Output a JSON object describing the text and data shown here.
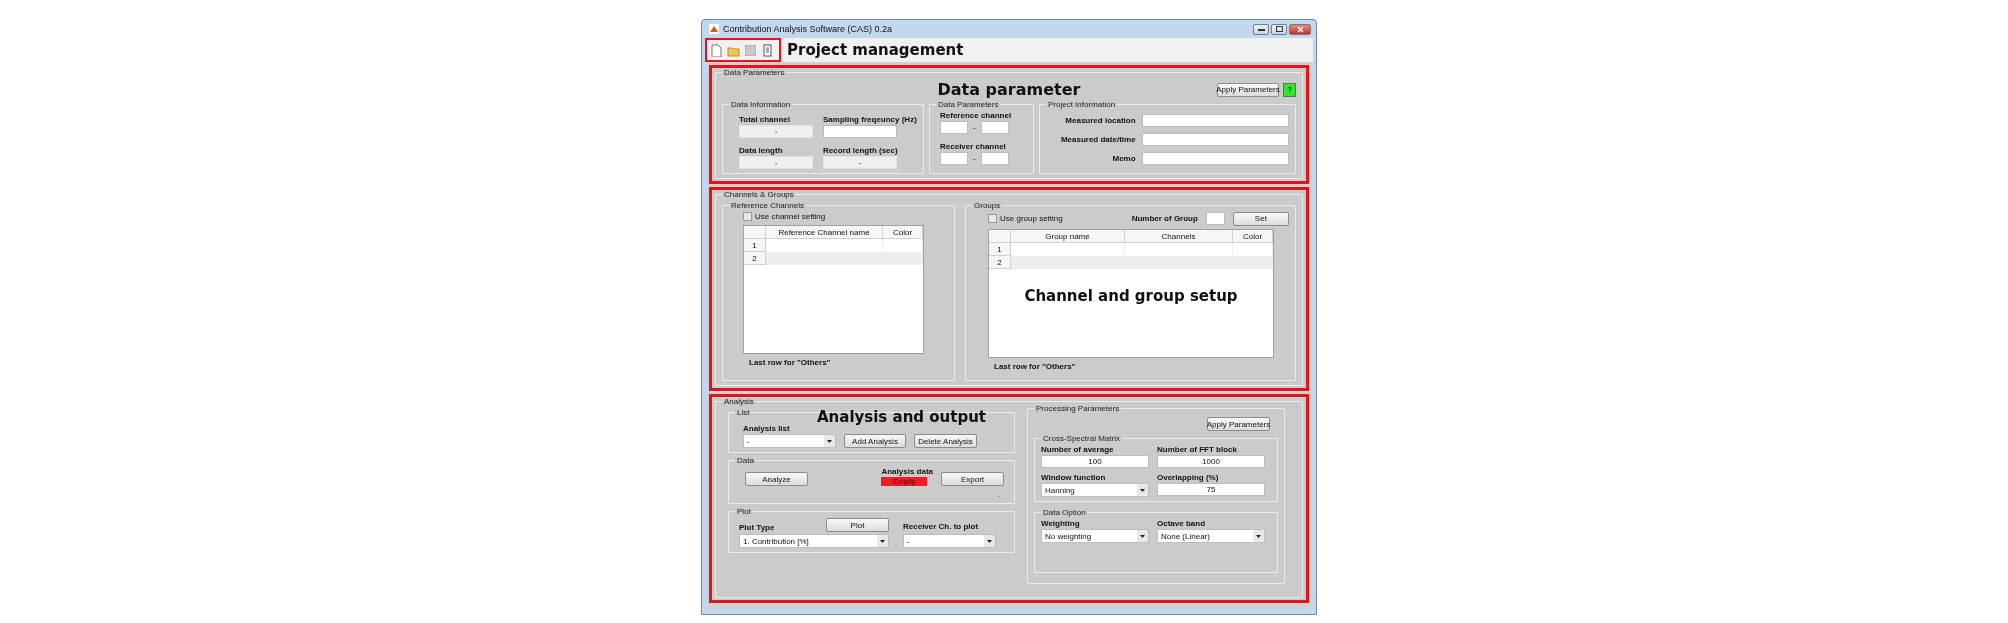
{
  "window": {
    "title": "Contribution Analysis Software (CAS) 0.2a"
  },
  "toolbar": {
    "annotation": "Project management",
    "items": [
      {
        "kind": "new",
        "disabled": false
      },
      {
        "kind": "open",
        "disabled": false
      },
      {
        "kind": "save",
        "disabled": true
      },
      {
        "kind": "report",
        "disabled": false
      }
    ]
  },
  "data_parameters": {
    "title": "Data Parameters",
    "annotation": "Data parameter",
    "apply_button": "Apply Parameters",
    "help_button": "?",
    "data_information": {
      "title": "Data Information",
      "fields": [
        {
          "label": "Total channel",
          "value": "-",
          "editable": false
        },
        {
          "label": "Sampling freqeuncy (Hz)",
          "editable": true
        },
        {
          "label": "Data length",
          "value": "-",
          "editable": false
        },
        {
          "label": "Record length (sec)",
          "value": "-",
          "editable": false
        }
      ]
    },
    "channel_ranges": {
      "title": "Data Parameters",
      "ranges": [
        {
          "label": "Reference channel",
          "separator": "-"
        },
        {
          "label": "Receiver channel",
          "separator": "-"
        }
      ]
    },
    "project_information": {
      "title": "Project Information",
      "fields": [
        {
          "label": "Measured location"
        },
        {
          "label": "Measured date/time"
        },
        {
          "label": "Memo"
        }
      ]
    }
  },
  "channels_groups": {
    "title": "Channels & Groups",
    "annotation": "Channel and group setup",
    "reference_channels": {
      "title": "Reference Channels",
      "checkbox": {
        "label": "Use channel setting",
        "checked": false
      },
      "table": {
        "columns": [
          "Reference Channel name",
          "Color"
        ],
        "row_headers": [
          "1",
          "2"
        ]
      },
      "note": "Last row for \"Others\""
    },
    "groups": {
      "title": "Groups",
      "checkbox": {
        "label": "Use group setting",
        "checked": false
      },
      "count_label": "Number of Group",
      "set_button": "Set",
      "table": {
        "columns": [
          "Group name",
          "Channels",
          "Color"
        ],
        "row_headers": [
          "1",
          "2"
        ]
      },
      "note": "Last row for \"Others\""
    }
  },
  "analysis": {
    "title": "Analysis",
    "annotation": "Analysis and output",
    "list": {
      "title": "List",
      "label": "Analysis list",
      "select": "-",
      "buttons": [
        "Add Analysis",
        "Delete Analysis"
      ]
    },
    "data": {
      "title": "Data",
      "analyze_button": "Analyze",
      "status_label": "Analysis data",
      "status": "Empty",
      "export_button": "Export",
      "mark": "."
    },
    "plot": {
      "title": "Plot",
      "type_label": "Plot Type",
      "plot_button": "Plot",
      "type_select": "1. Contribution [%]",
      "receiver_label": "Receiver Ch. to plot",
      "receiver_select": "-"
    },
    "processing": {
      "title": "Processing Parameters",
      "apply_button": "Apply Parameters",
      "csm": {
        "title": "Cross-Spectral Matrix",
        "fields": [
          {
            "label": "Number of average",
            "value": "100",
            "kind": "input"
          },
          {
            "label": "Number of FFT block",
            "value": "1000",
            "kind": "input"
          },
          {
            "label": "Window function",
            "value": "Hanning",
            "kind": "select"
          },
          {
            "label": "Overlapping (%)",
            "value": "75",
            "kind": "input"
          }
        ]
      },
      "data_option": {
        "title": "Data Option",
        "fields": [
          {
            "label": "Weighting",
            "value": "No weighting",
            "kind": "select"
          },
          {
            "label": "Octave band",
            "value": "None (Linear)",
            "kind": "select"
          }
        ]
      }
    }
  }
}
